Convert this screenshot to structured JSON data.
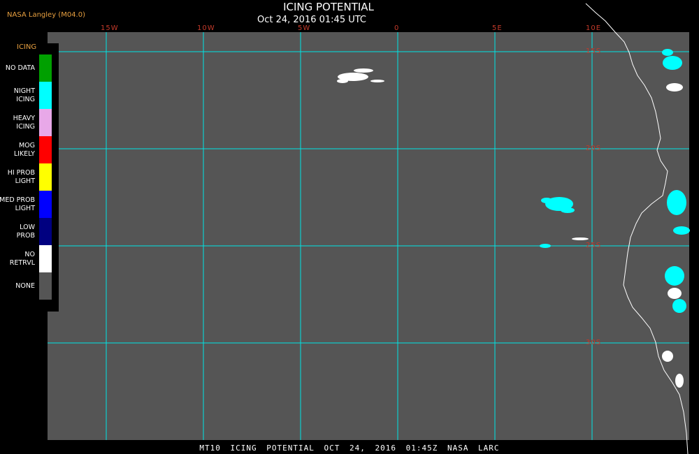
{
  "header": {
    "source": "NASA Langley (M04.0)",
    "title": "ICING POTENTIAL",
    "subtitle": "Oct 24, 2016 01:45 UTC"
  },
  "footer": {
    "text": "MT10  ICING POTENTIAL   OCT 24, 2016 01:45Z   NASA LARC"
  },
  "legend": {
    "title": "ICING",
    "items": [
      {
        "label": "NO DATA",
        "color": "#00a000"
      },
      {
        "label": "NIGHT\nICING",
        "color": "#00ffff"
      },
      {
        "label": "HEAVY\nICING",
        "color": "#e8a8e8"
      },
      {
        "label": "MOG\nLIKELY",
        "color": "#ff0000"
      },
      {
        "label": "HI PROB\nLIGHT",
        "color": "#ffff00"
      },
      {
        "label": "MED PROB\nLIGHT",
        "color": "#0000ff"
      },
      {
        "label": "LOW\nPROB",
        "color": "#000080"
      },
      {
        "label": "NO\nRETRVL",
        "color": "#ffffff"
      },
      {
        "label": "NONE",
        "color": "#555555"
      }
    ]
  },
  "grid": {
    "lon_labels": [
      "15W",
      "10W",
      "5W",
      "0",
      "5E",
      "10E"
    ],
    "lat_labels": [
      "15S",
      "20S",
      "25S",
      "30S"
    ],
    "grid_color": "#00e5e5",
    "label_color": "#c33a2a",
    "background_color": "#555555",
    "coast_color": "#ffffff"
  }
}
